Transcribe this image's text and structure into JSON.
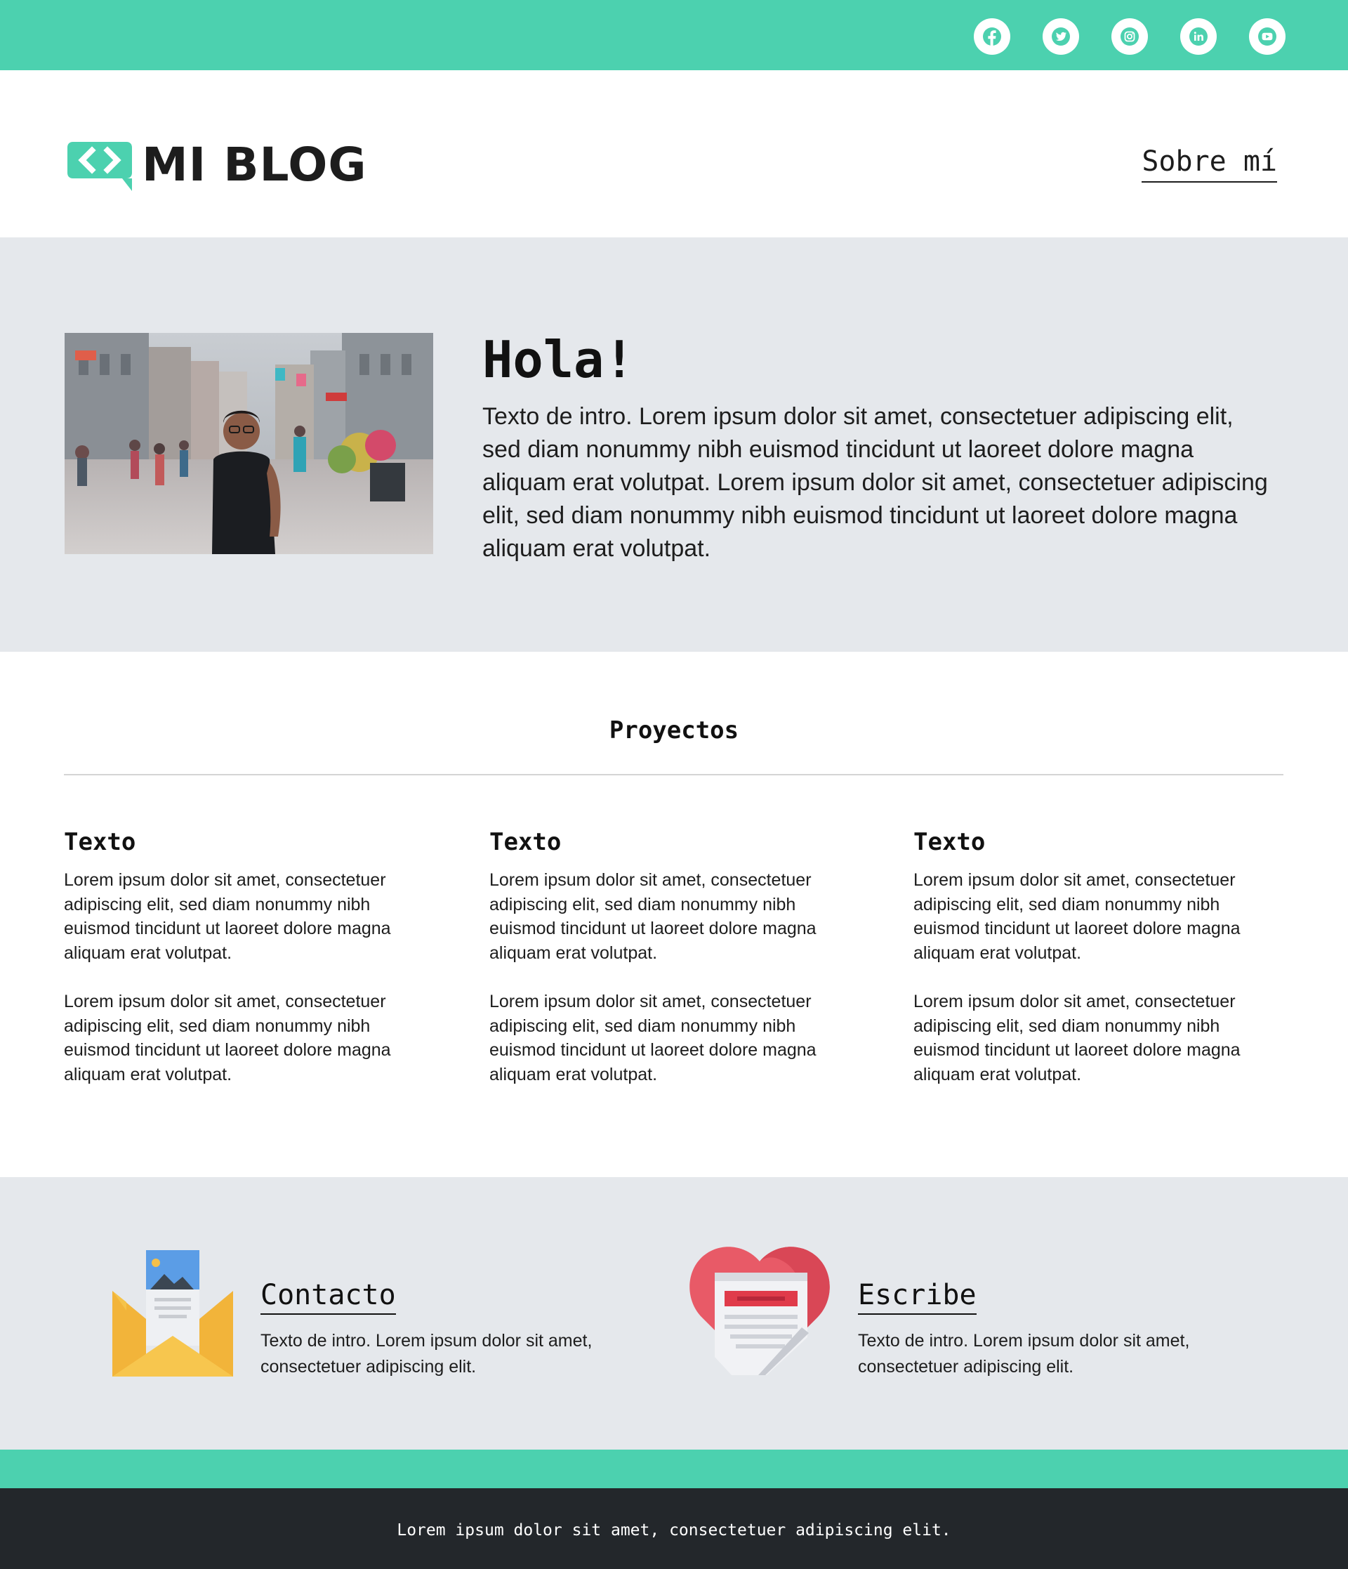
{
  "colors": {
    "accent": "#4cd1af",
    "band": "#e5e8ec",
    "footer": "#23272b",
    "text": "#1d1d1d"
  },
  "social": [
    {
      "icon": "facebook-icon"
    },
    {
      "icon": "twitter-icon"
    },
    {
      "icon": "instagram-icon"
    },
    {
      "icon": "linkedin-icon"
    },
    {
      "icon": "youtube-icon"
    }
  ],
  "header": {
    "logo_text": "MI BLOG",
    "logo_icon": "code-chat-bubble-icon",
    "nav_link": "Sobre mí"
  },
  "hero": {
    "title": "Hola!",
    "text": "Texto de intro. Lorem ipsum dolor sit amet, consectetuer adipiscing elit, sed diam nonummy nibh euismod tincidunt ut laoreet dolore magna aliquam erat volutpat. Lorem ipsum dolor sit amet, consectetuer adipiscing elit, sed diam nonummy nibh euismod tincidunt ut laoreet dolore magna aliquam erat volutpat."
  },
  "projects": {
    "title": "Proyectos",
    "items": [
      {
        "title": "Texto",
        "p1": "Lorem ipsum dolor sit amet, consectetuer adipiscing elit, sed diam nonummy nibh euismod tincidunt ut laoreet dolore magna aliquam erat volutpat.",
        "p2": "Lorem ipsum dolor sit amet, consectetuer adipiscing elit, sed diam nonummy nibh euismod tincidunt ut laoreet dolore magna aliquam erat volutpat."
      },
      {
        "title": "Texto",
        "p1": "Lorem ipsum dolor sit amet, consectetuer adipiscing elit, sed diam nonummy nibh euismod tincidunt ut laoreet dolore magna aliquam erat volutpat.",
        "p2": "Lorem ipsum dolor sit amet, consectetuer adipiscing elit, sed diam nonummy nibh euismod tincidunt ut laoreet dolore magna aliquam erat volutpat."
      },
      {
        "title": "Texto",
        "p1": "Lorem ipsum dolor sit amet, consectetuer adipiscing elit, sed diam nonummy nibh euismod tincidunt ut laoreet dolore magna aliquam erat volutpat.",
        "p2": "Lorem ipsum dolor sit amet, consectetuer adipiscing elit, sed diam nonummy nibh euismod tincidunt ut laoreet dolore magna aliquam erat volutpat."
      }
    ]
  },
  "band": {
    "contact": {
      "icon": "envelope-icon",
      "title": "Contacto",
      "text": "Texto de intro. Lorem ipsum dolor sit amet, consectetuer adipiscing elit."
    },
    "write": {
      "icon": "heart-letter-icon",
      "title": "Escribe",
      "text": "Texto de intro. Lorem ipsum dolor sit amet, consectetuer adipiscing elit."
    }
  },
  "footer": {
    "text": "Lorem ipsum dolor sit amet, consectetuer adipiscing elit."
  }
}
